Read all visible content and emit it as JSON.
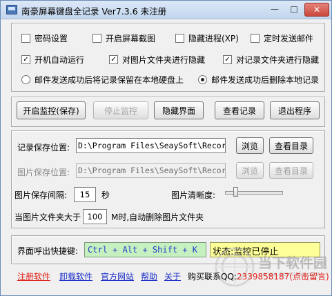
{
  "window": {
    "title": "南豪屏幕键盘全记录  Ver7.3.6  未注册",
    "min_glyph": "—",
    "max_glyph": "□",
    "close_glyph": "✕"
  },
  "options": {
    "row1": [
      {
        "label": "密码设置",
        "checked": false
      },
      {
        "label": "开启屏幕截图",
        "checked": false
      },
      {
        "label": "隐藏进程(XP)",
        "checked": false
      },
      {
        "label": "定时发送邮件",
        "checked": false
      }
    ],
    "row2": [
      {
        "label": "开机自动运行",
        "checked": true
      },
      {
        "label": "对图片文件夹进行隐藏",
        "checked": true
      },
      {
        "label": "对记录文件夹进行隐藏",
        "checked": true
      }
    ],
    "radios": [
      {
        "label": "邮件发送成功后将记录保留在本地硬盘上",
        "selected": false
      },
      {
        "label": "邮件发送成功后删除本地记录",
        "selected": true
      }
    ],
    "check_mark": "✓"
  },
  "actions": {
    "start": "开启监控(保存)",
    "stop": "停止监控",
    "hide": "隐藏界面",
    "view": "查看记录",
    "exit": "退出程序"
  },
  "paths": {
    "record_label": "记录保存位置:",
    "record_value": "D:\\Program Files\\SeaySoft\\Record",
    "image_label": "图片保存位置:",
    "image_value": "D:\\Program Files\\SeaySoft\\Record",
    "browse": "浏览",
    "view_dir": "查看目录",
    "interval_label": "图片保存间隔:",
    "interval_value": "15",
    "interval_unit": "秒",
    "clarity_label": "图片清晰度:",
    "clarity_level": 0.15,
    "folder_limit_prefix": "当图片文件夹大于",
    "folder_limit_value": "100",
    "folder_limit_suffix": "M时,自动删除图片文件夹"
  },
  "bottom": {
    "hotkey_label": "界面呼出快捷键:",
    "hotkey_value": "Ctrl + Alt + Shift + K",
    "status_text": "状态:监控已停止"
  },
  "links": {
    "register": "注册软件",
    "uninstall": "卸载软件",
    "website": "官方网站",
    "help": "帮助",
    "about": "关于",
    "contact_label": "购买联系QQ:",
    "contact_value": "2339858187(点击留言)"
  },
  "watermark": {
    "brand": "当下软件园",
    "url": "www.downxia.com"
  },
  "colors": {
    "hotkey_bg": "#c6f0c0",
    "status_bg": "#ffff99",
    "link_red": "#e0201a",
    "link_blue": "#1a2cc8"
  }
}
